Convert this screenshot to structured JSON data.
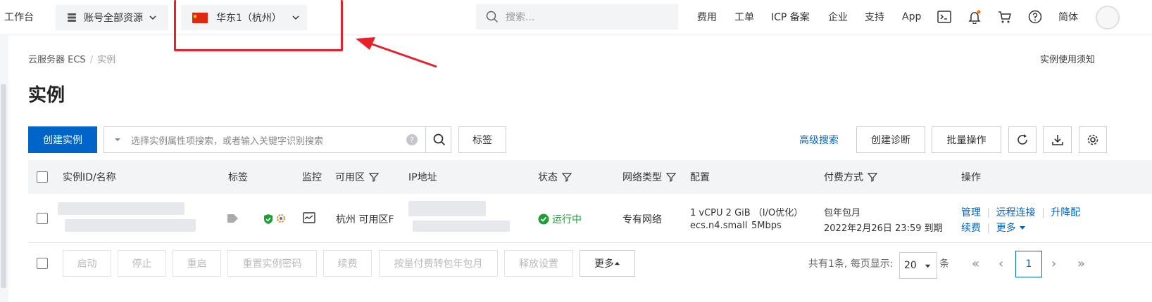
{
  "topbar": {
    "workbench": "工作台",
    "resources": "账号全部资源",
    "region": "华东1（杭州）",
    "search_placeholder": "搜索...",
    "nav": [
      "费用",
      "工单",
      "ICP 备案",
      "企业",
      "支持",
      "App"
    ],
    "language": "简体"
  },
  "breadcrumb": {
    "root": "云服务器 ECS",
    "current": "实例"
  },
  "notice": "实例使用须知",
  "page_title": "实例",
  "toolbar": {
    "create": "创建实例",
    "filter_placeholder": "选择实例属性项搜索，或者输入关键字识别搜索",
    "tags": "标签",
    "advanced_search": "高级搜索",
    "diagnose": "创建诊断",
    "batch": "批量操作"
  },
  "table": {
    "headers": {
      "id": "实例ID/名称",
      "tags": "标签",
      "monitor": "监控",
      "zone": "可用区",
      "ip": "IP地址",
      "status": "状态",
      "network": "网络类型",
      "config": "配置",
      "billing": "付费方式",
      "actions": "操作"
    },
    "row": {
      "zone": "杭州 可用区F",
      "status": "运行中",
      "network": "专有网络",
      "config_line1": "1 vCPU 2 GiB （I/O优化）",
      "config_type": "ecs.n4.small",
      "config_bw": "5Mbps",
      "billing_line1": "包年包月",
      "billing_line2": "2022年2月26日 23:59 到期",
      "action_manage": "管理",
      "action_remote": "远程连接",
      "action_upgrade": "升降配",
      "action_renew": "续费",
      "action_more": "更多"
    }
  },
  "footer": {
    "buttons": [
      "启动",
      "停止",
      "重启",
      "重置实例密码",
      "续费",
      "按量付费转包年包月",
      "释放设置"
    ],
    "more": "更多",
    "total": "共有1条, 每页显示:",
    "page_size": "20",
    "unit": "条",
    "current_page": "1"
  },
  "colors": {
    "primary": "#0064c8",
    "running": "#1e9e37",
    "annotation": "#e8202a"
  }
}
